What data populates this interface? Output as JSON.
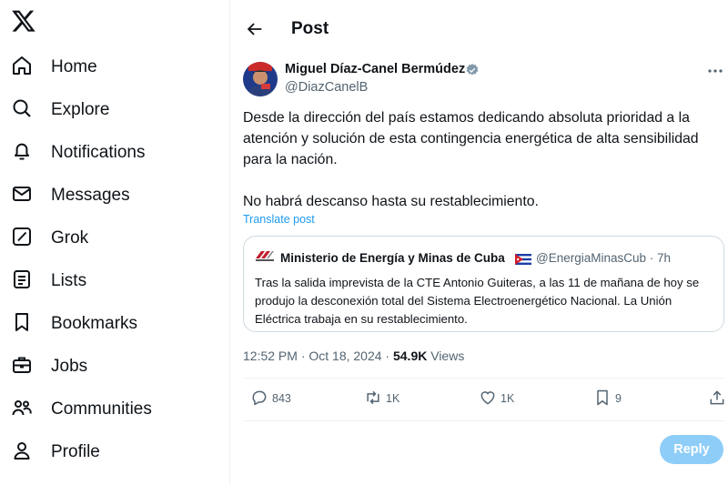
{
  "sidebar": {
    "items": [
      {
        "label": "Home",
        "icon": "home-icon"
      },
      {
        "label": "Explore",
        "icon": "search-icon"
      },
      {
        "label": "Notifications",
        "icon": "bell-icon"
      },
      {
        "label": "Messages",
        "icon": "envelope-icon"
      },
      {
        "label": "Grok",
        "icon": "grok-icon"
      },
      {
        "label": "Lists",
        "icon": "list-icon"
      },
      {
        "label": "Bookmarks",
        "icon": "bookmark-icon"
      },
      {
        "label": "Jobs",
        "icon": "briefcase-icon"
      },
      {
        "label": "Communities",
        "icon": "people-icon"
      },
      {
        "label": "Profile",
        "icon": "person-icon"
      }
    ]
  },
  "header": {
    "title": "Post"
  },
  "post": {
    "author_name": "Miguel Díaz-Canel Bermúdez",
    "author_handle": "@DiazCanelB",
    "text_p1": "Desde la dirección del país estamos dedicando absoluta prioridad a la atención y solución de esta contingencia energética de alta sensibilidad para la nación.",
    "text_p2": "No habrá descanso hasta su restablecimiento.",
    "translate_label": "Translate post",
    "quote": {
      "author_name": "Ministerio de Energía y Minas de Cuba",
      "author_handle": "@EnergiaMinasCub · 7h",
      "text": "Tras la salida imprevista de la CTE Antonio Guiteras, a las 11 de mañana de hoy se produjo la desconexión total del Sistema Electroenergético Nacional. La Unión Eléctrica trabaja en su restablecimiento."
    },
    "timestamp": "12:52 PM · Oct 18, 2024 · ",
    "views_count": "54.9K",
    "views_label": " Views",
    "actions": {
      "replies": "843",
      "reposts": "1K",
      "likes": "1K",
      "bookmarks": "9"
    }
  },
  "reply_button": "Reply",
  "colors": {
    "accent": "#1d9bf0",
    "reply_disabled": "#8ecdf8",
    "text": "#0f1419",
    "muted": "#536471"
  }
}
